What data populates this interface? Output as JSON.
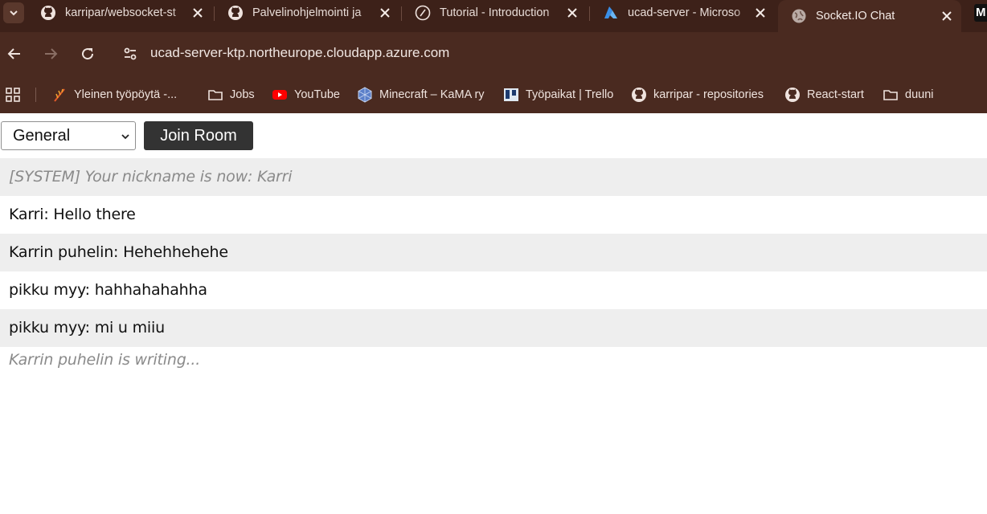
{
  "browser": {
    "tabs": [
      {
        "title": "karripar/websocket-st",
        "icon": "github-icon"
      },
      {
        "title": "Palvelinohjelmointi ja",
        "icon": "github-icon"
      },
      {
        "title": "Tutorial - Introduction",
        "icon": "nextjs-icon"
      },
      {
        "title": "ucad-server - Microso",
        "icon": "azure-icon"
      },
      {
        "title": "Socket.IO Chat",
        "icon": "globe-icon",
        "active": true
      }
    ],
    "overflow_tab_label": "M",
    "url": "ucad-server-ktp.northeurope.cloudapp.azure.com",
    "bookmarks": [
      {
        "label": "Yleinen työpöytä -...",
        "icon": "feather-icon"
      },
      {
        "label": "Jobs",
        "icon": "folder-icon"
      },
      {
        "label": "YouTube",
        "icon": "youtube-icon"
      },
      {
        "label": "Minecraft – KaMA ry",
        "icon": "minecraft-icon"
      },
      {
        "label": "Työpaikat | Trello",
        "icon": "trello-icon"
      },
      {
        "label": "karripar - repositories",
        "icon": "github-icon"
      },
      {
        "label": "React-start",
        "icon": "github-icon"
      },
      {
        "label": "duuni",
        "icon": "folder-icon"
      }
    ],
    "colors": {
      "chrome": "#4a2a20",
      "tabstrip": "#3d2119"
    }
  },
  "page": {
    "room_select_value": "General",
    "join_button_label": "Join Room",
    "messages": [
      {
        "text": "[SYSTEM] Your nickname is now: Karri",
        "system": true
      },
      {
        "text": "Karri: Hello there"
      },
      {
        "text": "Karrin puhelin: Hehehhehehe"
      },
      {
        "text": "pikku myy: hahhahahahha"
      },
      {
        "text": "pikku myy: mi u miiu"
      }
    ],
    "typing_indicator": "Karrin puhelin is writing...",
    "colors": {
      "button_bg": "#333333",
      "alt_row": "#eeeeee",
      "system_text": "#8a8a8a"
    }
  }
}
